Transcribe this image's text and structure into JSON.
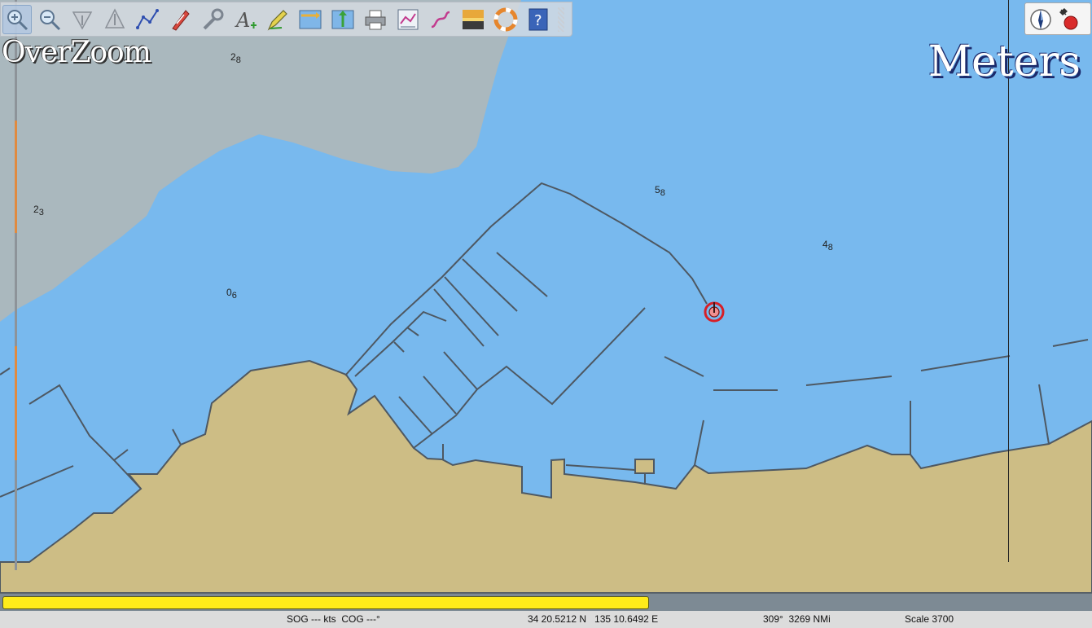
{
  "app": {
    "overzoom_label": "OverZoom",
    "units_label": "Meters"
  },
  "toolbar": {
    "buttons": [
      {
        "name": "zoom-in",
        "active": true
      },
      {
        "name": "zoom-out",
        "active": false
      },
      {
        "name": "scale-in",
        "active": false
      },
      {
        "name": "scale-out",
        "active": false
      },
      {
        "name": "create-route",
        "active": false
      },
      {
        "name": "auto-follow",
        "active": false
      },
      {
        "name": "options",
        "active": false
      },
      {
        "name": "text",
        "active": false
      },
      {
        "name": "quilt",
        "active": false
      },
      {
        "name": "current",
        "active": false
      },
      {
        "name": "tide",
        "active": false
      },
      {
        "name": "print",
        "active": false
      },
      {
        "name": "route-manager",
        "active": false
      },
      {
        "name": "track",
        "active": false
      },
      {
        "name": "color-scheme",
        "active": false
      },
      {
        "name": "mob",
        "active": false
      },
      {
        "name": "help",
        "active": false
      }
    ]
  },
  "soundings": [
    {
      "depth": "2",
      "sub": "8"
    },
    {
      "depth": "2",
      "sub": "3"
    },
    {
      "depth": "0",
      "sub": "6"
    },
    {
      "depth": "5",
      "sub": "8"
    },
    {
      "depth": "4",
      "sub": "8"
    }
  ],
  "scale_bar": {
    "fill_fraction": 0.593
  },
  "status": {
    "sog_cog": "SOG --- kts  COG ---°",
    "position": "34 20.5212 N   135 10.6492 E",
    "bearing_distance": "309°  3269 NMi",
    "scale": "Scale 3700"
  },
  "colors": {
    "water": "#78b9ee",
    "land": "#cdbd85",
    "shallow_land": "#aab8be",
    "scale_bar_fill": "#ffec1a"
  }
}
